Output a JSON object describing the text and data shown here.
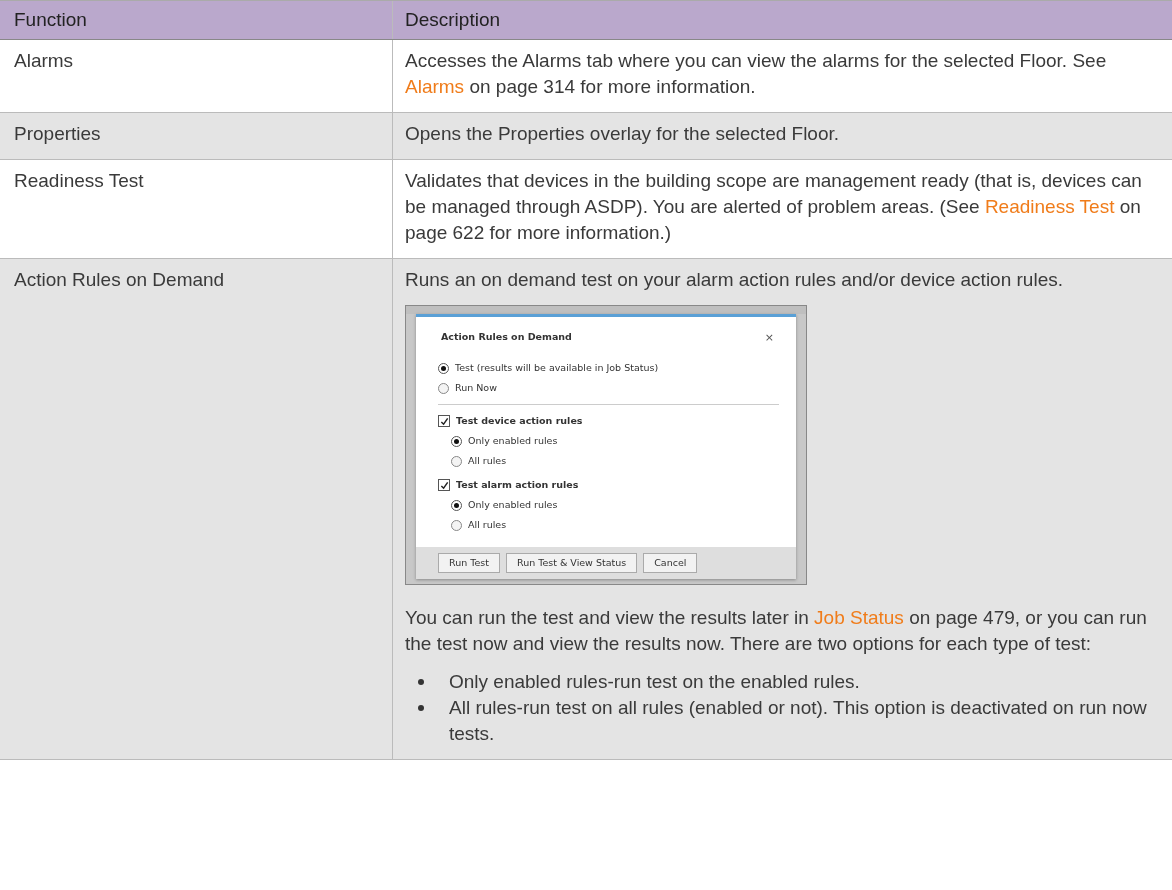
{
  "table": {
    "columns": [
      "Function",
      "Description"
    ],
    "rows": [
      {
        "function": "Alarms",
        "blocks": [
          {
            "kind": "paragraph",
            "segments": [
              {
                "kind": "text",
                "text": "Accesses the Alarms tab where you can view the alarms for the selected Floor. See "
              },
              {
                "kind": "link",
                "text": "Alarms"
              },
              {
                "kind": "text",
                "text": " on page 314 for more information."
              }
            ]
          }
        ]
      },
      {
        "function": "Properties",
        "blocks": [
          {
            "kind": "paragraph",
            "segments": [
              {
                "kind": "text",
                "text": "Opens the Properties overlay for the selected Floor."
              }
            ]
          }
        ]
      },
      {
        "function": "Readiness Test",
        "blocks": [
          {
            "kind": "paragraph",
            "segments": [
              {
                "kind": "text",
                "text": "Validates that devices in the building scope are management ready (that is, devices can be managed through ASDP). You are alerted of problem areas. (See "
              },
              {
                "kind": "link",
                "text": "Readiness Test"
              },
              {
                "kind": "text",
                "text": " on page 622 for more information.)"
              }
            ]
          }
        ]
      },
      {
        "function": "Action Rules on Demand",
        "blocks": [
          {
            "kind": "paragraph",
            "segments": [
              {
                "kind": "text",
                "text": "Runs an on demand test on your alarm action rules and/or device action rules."
              }
            ]
          },
          {
            "kind": "dialog",
            "title": "Action Rules on Demand",
            "close": "×",
            "modes": [
              {
                "label": "Test (results will be available in Job Status)",
                "selected": true
              },
              {
                "label": "Run Now",
                "selected": false
              }
            ],
            "groups": [
              {
                "label": "Test device action rules",
                "checked": true,
                "options": [
                  {
                    "label": "Only enabled rules",
                    "selected": true
                  },
                  {
                    "label": "All rules",
                    "selected": false
                  }
                ]
              },
              {
                "label": "Test alarm action rules",
                "checked": true,
                "options": [
                  {
                    "label": "Only enabled rules",
                    "selected": true
                  },
                  {
                    "label": "All rules",
                    "selected": false
                  }
                ]
              }
            ],
            "buttons": [
              "Run Test",
              "Run Test & View Status",
              "Cancel"
            ]
          },
          {
            "kind": "paragraph",
            "segments": [
              {
                "kind": "text",
                "text": "You can run the test and view the results later in "
              },
              {
                "kind": "link",
                "text": "Job Status"
              },
              {
                "kind": "text",
                "text": " on page 479, or you can run the test now and view the results now. There are two options for each type of test:"
              }
            ]
          },
          {
            "kind": "bullets",
            "items": [
              "Only enabled rules-run test on the enabled rules.",
              "All rules-run test on all rules (enabled or not). This option is deactivated on run now tests."
            ]
          }
        ]
      }
    ]
  }
}
